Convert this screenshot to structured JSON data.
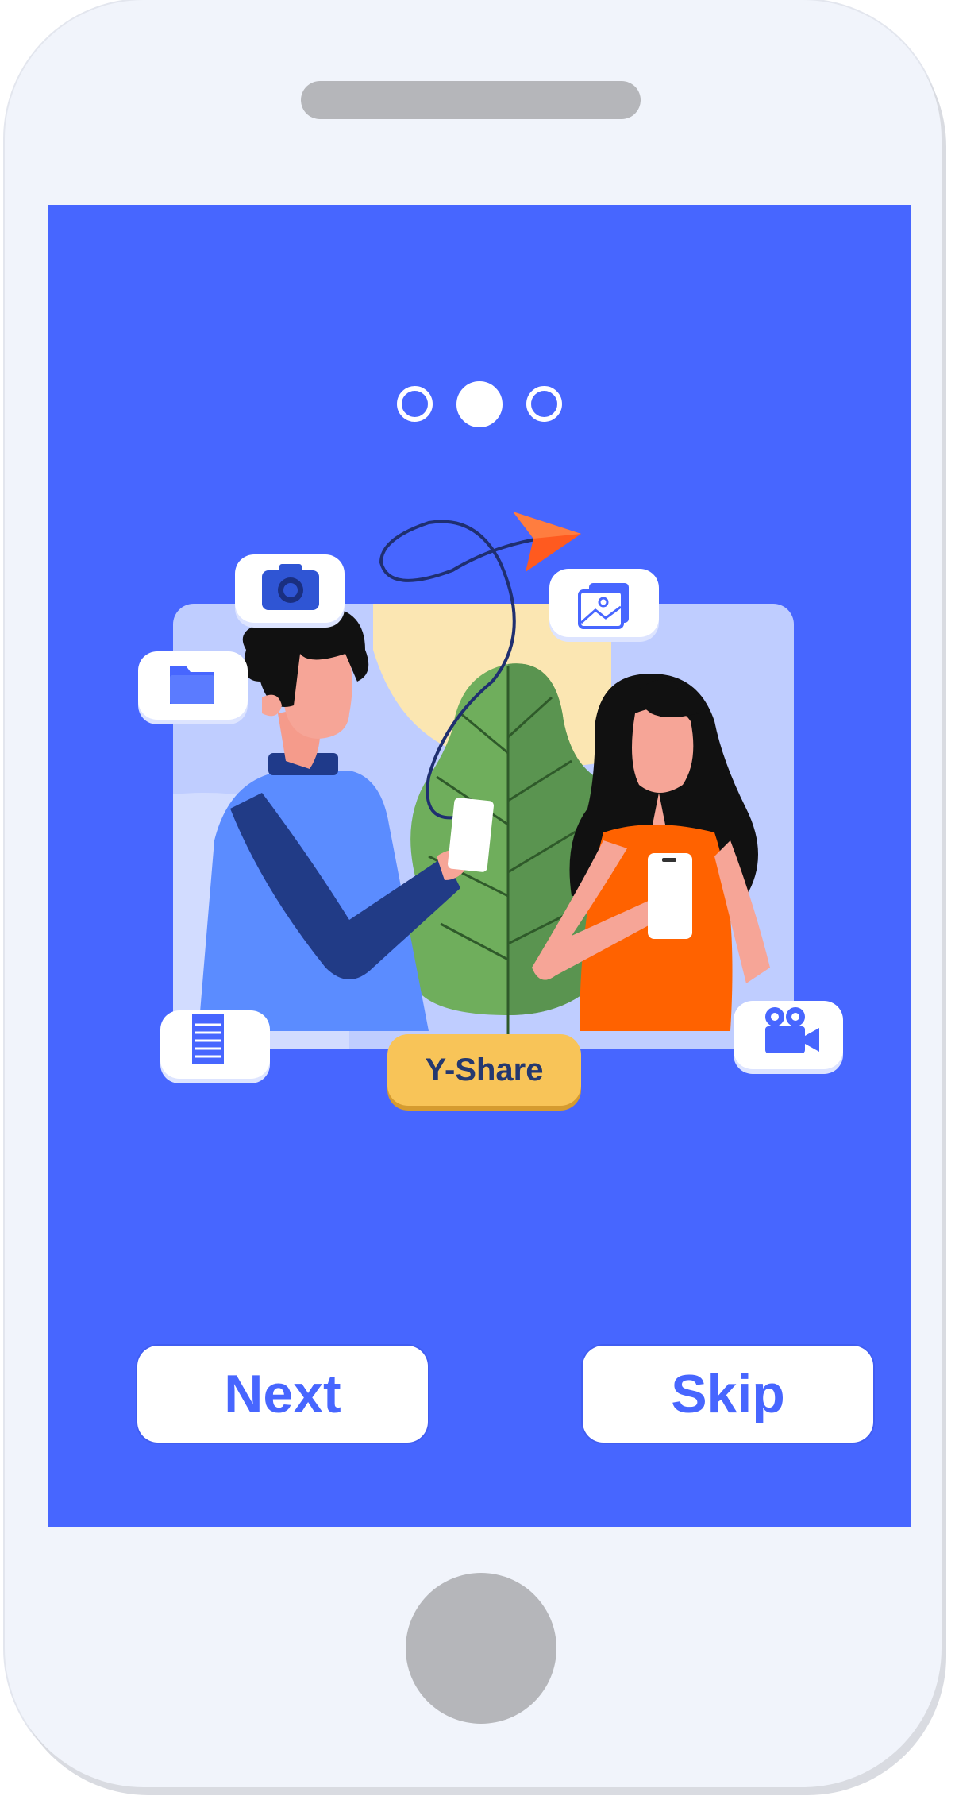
{
  "app": {
    "badge_label": "Y-Share"
  },
  "onboarding": {
    "page_indicator": {
      "total": 3,
      "active_index": 1
    }
  },
  "actions": {
    "next_label": "Next",
    "skip_label": "Skip"
  },
  "floating_icons": [
    "camera-icon",
    "folder-icon",
    "image-icon",
    "document-icon",
    "video-camera-icon"
  ],
  "colors": {
    "screen_background": "#4766ff",
    "frame": "#f1f4fb",
    "accent_yellow": "#f8c458",
    "accent_orange": "#ff6200",
    "button_text": "#4766ff"
  }
}
